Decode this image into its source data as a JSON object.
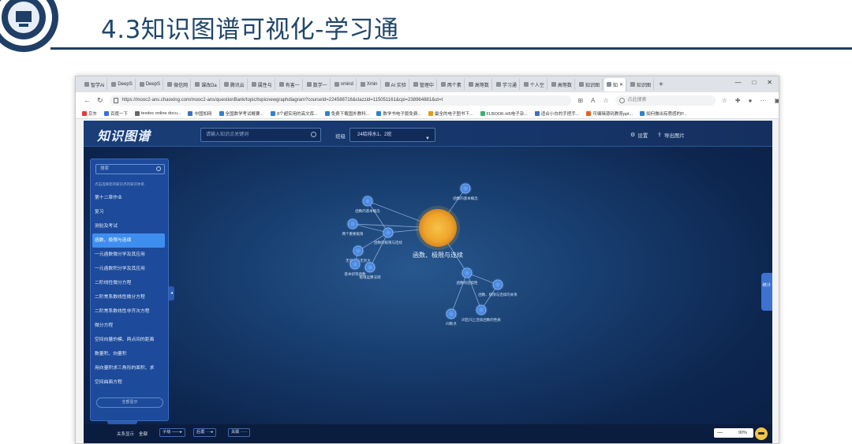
{
  "slide": {
    "title": "4.3知识图谱可视化-学习通",
    "colors": {
      "title": "#20476b",
      "rule": "#1f3f66"
    }
  },
  "browser": {
    "tabs": [
      {
        "label": "智学Ai"
      },
      {
        "label": "DeepS"
      },
      {
        "label": "DeepS"
      },
      {
        "label": "微信网"
      },
      {
        "label": "课改Da"
      },
      {
        "label": "腾讯云"
      },
      {
        "label": "属性与"
      },
      {
        "label": "有害一"
      },
      {
        "label": "数学一"
      },
      {
        "label": "xmind"
      },
      {
        "label": "Xmin"
      },
      {
        "label": "AI 实验"
      },
      {
        "label": "管理中"
      },
      {
        "label": "两个素"
      },
      {
        "label": "高等数"
      },
      {
        "label": "学习通"
      },
      {
        "label": "个人空"
      },
      {
        "label": "高等数"
      },
      {
        "label": "知识图"
      },
      {
        "label": "知"
      },
      {
        "label": "知识图"
      }
    ],
    "new_tab": "+",
    "window_controls": [
      "—",
      "□",
      "✕"
    ],
    "url": "https://mooc2-ans.chaoxing.com/mooc2-ans/questionBank/topic/topicnewgraphdiagram?courseId=224588716&clazzid=115051161&cpi=238964881&ut=t",
    "search_placeholder": "点此搜索",
    "bookmarks": [
      {
        "label": "京东",
        "color": "#e23c3c"
      },
      {
        "label": "百度一下",
        "color": "#3b6fe0"
      },
      {
        "label": "texdoc online docu...",
        "color": "#666666"
      },
      {
        "label": "中国知网",
        "color": "#3a72c4"
      },
      {
        "label": "全国数学考试概要...",
        "color": "#2f80d0"
      },
      {
        "label": "8个超实用的高文库...",
        "color": "#2f80d0"
      },
      {
        "label": "免费下载国外教科...",
        "color": "#2f80d0"
      },
      {
        "label": "数学书电子版免费...",
        "color": "#2f80d0"
      },
      {
        "label": "最全的电子图书下...",
        "color": "#e59a1f"
      },
      {
        "label": "FLBOOK-H5电子杂...",
        "color": "#3cb371"
      },
      {
        "label": "适合小白的手把手...",
        "color": "#3a72c4"
      },
      {
        "label": "可编辑源码教育ppt...",
        "color": "#e2622a"
      },
      {
        "label": "如何做出有质感的P...",
        "color": "#2f80d0"
      }
    ]
  },
  "app": {
    "logo": "知识图谱",
    "search_placeholder": "请输入知识点关键词",
    "class_label": "班级",
    "class_value": "24给排水1、2班",
    "settings_label": "设置",
    "export_label": "导出图片",
    "sidebar": {
      "search_placeholder": "搜索",
      "hint": "点击选择您的知识点的知识体系",
      "items": [
        {
          "label": "第十二章作业",
          "active": false
        },
        {
          "label": "复习",
          "active": false
        },
        {
          "label": "测验及考试",
          "active": false
        },
        {
          "label": "函数、极限与连续",
          "active": true
        },
        {
          "label": "一元函数微分学及其应用",
          "active": false
        },
        {
          "label": "一元函数积分学及其应用",
          "active": false
        },
        {
          "label": "二阶线性微分方程",
          "active": false
        },
        {
          "label": "二阶常系数线性微分方程",
          "active": false
        },
        {
          "label": "二阶常系数线性非齐次方程",
          "active": false
        },
        {
          "label": "微分方程",
          "active": false
        },
        {
          "label": "空间向量的模、两点间的距离",
          "active": false
        },
        {
          "label": "数量积、向量积",
          "active": false
        },
        {
          "label": "用向量积求三角形的面积、求",
          "active": false
        },
        {
          "label": "空间曲面方程",
          "active": false
        }
      ],
      "show_all": "全部显示"
    },
    "stats_tab": "统计",
    "bottombar": {
      "relation_label": "关系显示",
      "all_label": "全部",
      "chips": [
        "子级 ——▸",
        "后置 ····▸",
        "关联 ·····"
      ],
      "zoom": "90%"
    },
    "graph": {
      "center": {
        "label": "函数、极限与连续"
      },
      "nodes": [
        {
          "id": "n1",
          "label": "函数的基本概念"
        },
        {
          "id": "n2",
          "label": "函数的基本概念"
        },
        {
          "id": "n3",
          "label": "两个重要极限"
        },
        {
          "id": "n4",
          "label": "函数的极限与连续"
        },
        {
          "id": "n5",
          "label": "无穷小与无穷大"
        },
        {
          "id": "n6",
          "label": "基本初等函数"
        },
        {
          "id": "n7",
          "label": "极限运算法则"
        },
        {
          "id": "n8",
          "label": "函数的连续性"
        },
        {
          "id": "n9",
          "label": "函数、极限与连续的关系"
        },
        {
          "id": "n10",
          "label": "间断点"
        },
        {
          "id": "n11",
          "label": "闭区间上连续函数的性质"
        }
      ],
      "colors": {
        "center": "#f3b33a",
        "node": "#4e8fe8",
        "edge": "#8fb0dc"
      }
    }
  }
}
